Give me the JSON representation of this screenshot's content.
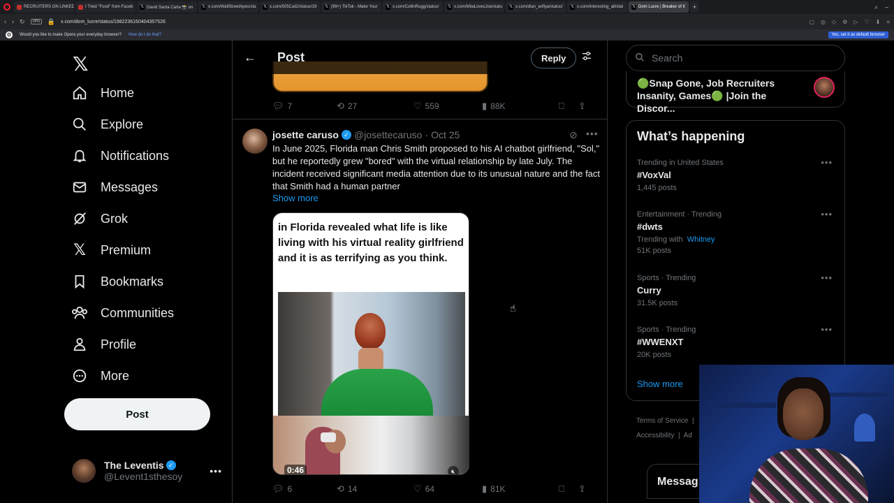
{
  "browser": {
    "tabs": [
      {
        "label": "RECRUITERS ON LINKEDIN",
        "color": "#c4302b",
        "active": false
      },
      {
        "label": "I Tried \"Food\" from Faceb",
        "color": "#c4302b",
        "active": false
      },
      {
        "label": "David Santa Carla 📸 on",
        "color": "#000000",
        "active": false
      },
      {
        "label": "x.com/WallStreetApes/sta",
        "color": "#000000",
        "active": false
      },
      {
        "label": "x.com/505Cali2/status/19",
        "color": "#000000",
        "active": false
      },
      {
        "label": "(99+) TikTok - Make Your",
        "color": "#000000",
        "active": false
      },
      {
        "label": "x.com/CollinRugg/status/",
        "color": "#000000",
        "active": false
      },
      {
        "label": "x.com/MilaLovesJoe/statu",
        "color": "#000000",
        "active": false
      },
      {
        "label": "x.com/dian_arifiya/status/",
        "color": "#000000",
        "active": false
      },
      {
        "label": "x.com/interesting_all/stat",
        "color": "#000000",
        "active": false
      },
      {
        "label": "Dom Lucre | Breaker of Il",
        "color": "#000000",
        "active": true
      }
    ],
    "vpn": "VPN",
    "url": "x.com/dom_lucre/status/1982236160404357526",
    "infobar_text": "Would you like to make Opera your everyday browser?",
    "infobar_link": "How do I do that?",
    "infobar_button": "Yes, set it as default browser"
  },
  "nav": {
    "items": [
      {
        "label": "Home",
        "icon": "home-icon"
      },
      {
        "label": "Explore",
        "icon": "search-icon"
      },
      {
        "label": "Notifications",
        "icon": "bell-icon"
      },
      {
        "label": "Messages",
        "icon": "envelope-icon"
      },
      {
        "label": "Grok",
        "icon": "grok-icon"
      },
      {
        "label": "Premium",
        "icon": "x-premium-icon"
      },
      {
        "label": "Bookmarks",
        "icon": "bookmark-icon"
      },
      {
        "label": "Communities",
        "icon": "communities-icon"
      },
      {
        "label": "Profile",
        "icon": "person-icon"
      },
      {
        "label": "More",
        "icon": "more-circle-icon"
      }
    ],
    "post_button": "Post",
    "account": {
      "name": "The Leventis",
      "handle": "@Levent1sthesoy"
    }
  },
  "header": {
    "title": "Post",
    "reply_button": "Reply"
  },
  "prev_tweet": {
    "replies": "7",
    "reposts": "27",
    "likes": "559",
    "views": "88K"
  },
  "tweet": {
    "name": "josette caruso",
    "handle": "@josettecaruso",
    "separator": "·",
    "date": "Oct 25",
    "text": "In June 2025, Florida man Chris Smith proposed to his AI chatbot girlfriend, \"Sol,\" but he reportedly grew \"bored\" with the virtual relationship by late July. The incident received significant media attention due to its unusual nature and the fact that Smith had a human partner",
    "show_more": "Show more",
    "video_caption": "in Florida revealed what life is like living with his virtual reality girlfriend and it is as terrifying as you think.",
    "video_time": "0:46",
    "replies": "6",
    "reposts": "14",
    "likes": "64",
    "views": "81K"
  },
  "right": {
    "search_placeholder": "Search",
    "community": "🟢Snap Gone, Job Recruiters Insanity, Games🟢 |Join the Discor...",
    "happening_title": "What’s happening",
    "trends": [
      {
        "meta": "Trending in United States",
        "name": "#VoxVal",
        "with": "",
        "with_name": "",
        "posts": "1,445 posts"
      },
      {
        "meta": "Entertainment · Trending",
        "name": "#dwts",
        "with": "Trending with",
        "with_name": "Whitney",
        "posts": "51K posts"
      },
      {
        "meta": "Sports · Trending",
        "name": "Curry",
        "with": "",
        "with_name": "",
        "posts": "31.5K posts"
      },
      {
        "meta": "Sports · Trending",
        "name": "#WWENXT",
        "with": "",
        "with_name": "",
        "posts": "20K posts"
      }
    ],
    "show_more": "Show more",
    "footer": {
      "terms": "Terms of Service",
      "sep": "|",
      "accessibility": "Accessibility",
      "ad": "Ad"
    },
    "messages": "Messag"
  },
  "colors": {
    "accent": "#1d9bf0",
    "background": "#000000",
    "border": "#2f3336",
    "muted": "#71767b"
  }
}
